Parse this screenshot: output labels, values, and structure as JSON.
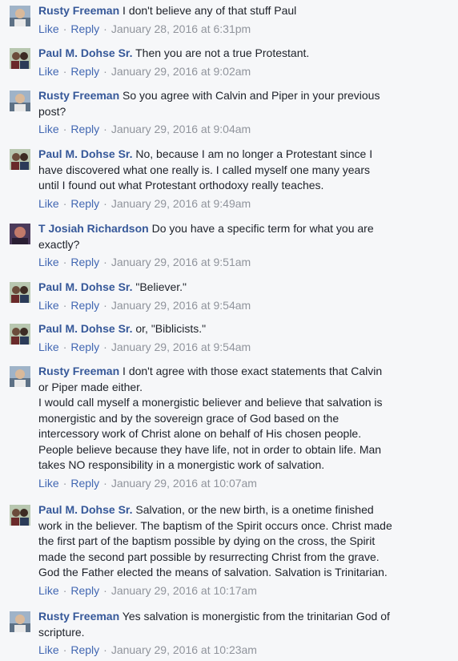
{
  "actions": {
    "like": "Like",
    "reply": "Reply",
    "separator": "·"
  },
  "comments": [
    {
      "author": "Rusty Freeman",
      "text": "I don't believe any of that stuff Paul",
      "time": "January 28, 2016 at 6:31pm",
      "avatar": "rusty-avatar"
    },
    {
      "author": "Paul M. Dohse Sr.",
      "text": "Then you are not a true Protestant.",
      "time": "January 29, 2016 at 9:02am",
      "avatar": "paul-avatar"
    },
    {
      "author": "Rusty Freeman",
      "text": "So you agree with Calvin and Piper in your previous\npost?",
      "time": "January 29, 2016 at 9:04am",
      "avatar": "rusty-avatar"
    },
    {
      "author": "Paul M. Dohse Sr.",
      "text": "No, because I am no longer a Protestant since I\nhave discovered what one really is. I called myself one many years\nuntil I found out what Protestant orthodoxy really teaches.",
      "time": "January 29, 2016 at 9:49am",
      "avatar": "paul-avatar"
    },
    {
      "author": "T Josiah Richardson",
      "text": "Do you have a specific term for what you are\nexactly?",
      "time": "January 29, 2016 at 9:51am",
      "avatar": "josiah-avatar"
    },
    {
      "author": "Paul M. Dohse Sr.",
      "text": "\"Believer.\"",
      "time": "January 29, 2016 at 9:54am",
      "avatar": "paul-avatar"
    },
    {
      "author": "Paul M. Dohse Sr.",
      "text": "or, \"Biblicists.\"",
      "time": "January 29, 2016 at 9:54am",
      "avatar": "paul-avatar"
    },
    {
      "author": "Rusty Freeman",
      "text": "I don't agree with those exact statements that Calvin\nor Piper made either.\nI would call myself a monergistic believer and believe that salvation is\nmonergistic and by the sovereign grace of God based on the\nintercessory work of Christ alone on behalf of His chosen people.\nPeople believe because they have life, not in order to obtain life. Man\ntakes NO responsibility in a monergistic work of salvation.",
      "time": "January 29, 2016 at 10:07am",
      "avatar": "rusty-avatar"
    },
    {
      "author": "Paul M. Dohse Sr.",
      "text": "Salvation, or the new birth, is a onetime finished\nwork in the believer. The baptism of the Spirit occurs once. Christ made\nthe first part of the baptism possible by dying on the cross, the Spirit\nmade the second part possible by resurrecting Christ from the grave.\nGod the Father elected the means of salvation. Salvation is Trinitarian.",
      "time": "January 29, 2016 at 10:17am",
      "avatar": "paul-avatar"
    },
    {
      "author": "Rusty Freeman",
      "text": "Yes salvation is monergistic from the trinitarian God of\nscripture.",
      "time": "January 29, 2016 at 10:23am",
      "avatar": "rusty-avatar"
    }
  ]
}
